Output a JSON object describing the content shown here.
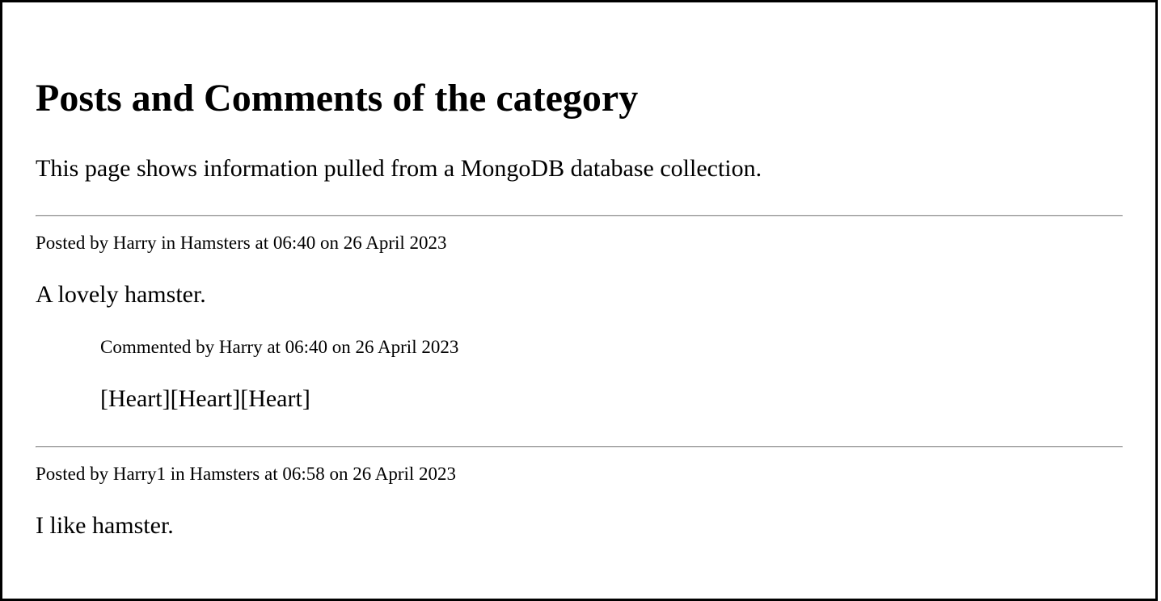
{
  "page": {
    "title": "Posts and Comments of the category",
    "intro": "This page shows information pulled from a MongoDB database collection."
  },
  "posts": [
    {
      "meta": "Posted by Harry in Hamsters at 06:40 on 26 April 2023",
      "body": "A lovely hamster.",
      "comments": [
        {
          "meta": "Commented by Harry at 06:40 on 26 April 2023",
          "body": "[Heart][Heart][Heart]"
        }
      ]
    },
    {
      "meta": "Posted by Harry1 in Hamsters at 06:58 on 26 April 2023",
      "body": "I like hamster.",
      "comments": []
    }
  ],
  "colors": {
    "text": "#000000",
    "background": "#ffffff",
    "divider": "#9a9a9a",
    "frame_border": "#000000"
  }
}
